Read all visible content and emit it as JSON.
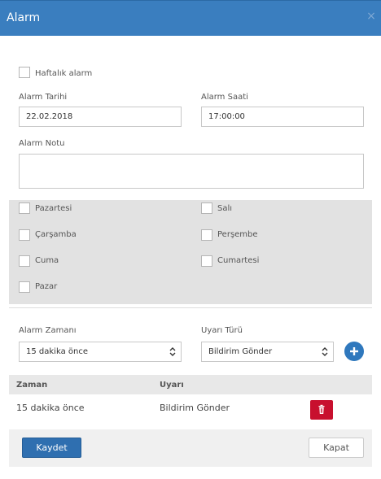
{
  "dialog": {
    "title": "Alarm",
    "close_label": "×"
  },
  "weekly": {
    "label": "Haftalık alarm",
    "checked": false
  },
  "date": {
    "label": "Alarm Tarihi",
    "value": "22.02.2018"
  },
  "time": {
    "label": "Alarm Saati",
    "value": "17:00:00"
  },
  "note": {
    "label": "Alarm Notu",
    "value": ""
  },
  "days": [
    {
      "label": "Pazartesi"
    },
    {
      "label": "Salı"
    },
    {
      "label": "Çarşamba"
    },
    {
      "label": "Perşembe"
    },
    {
      "label": "Cuma"
    },
    {
      "label": "Cumartesi"
    },
    {
      "label": "Pazar"
    }
  ],
  "alarm_time": {
    "label": "Alarm Zamanı",
    "selected": "15 dakika önce"
  },
  "warning_type": {
    "label": "Uyarı Türü",
    "selected": "Bildirim Gönder"
  },
  "table": {
    "columns": [
      "Zaman",
      "Uyarı"
    ],
    "rows": [
      {
        "zaman": "15 dakika önce",
        "uyari": "Bildirim Gönder"
      }
    ]
  },
  "buttons": {
    "save": "Kaydet",
    "close": "Kapat"
  },
  "colors": {
    "header": "#3a7ebf",
    "primary": "#2f6fb0",
    "danger": "#c8102e"
  }
}
